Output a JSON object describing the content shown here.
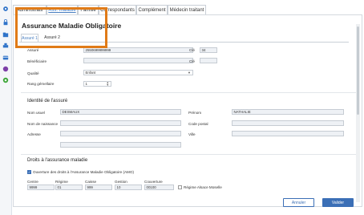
{
  "tabs": [
    {
      "label": "Administratif"
    },
    {
      "label": "Ass. maladie"
    },
    {
      "label": "Famille"
    },
    {
      "label": "Correspondants"
    },
    {
      "label": "Complément"
    },
    {
      "label": "Médecin traitant"
    }
  ],
  "form": {
    "title": "Assurance Maladie Obligatoire",
    "subtabs": [
      "Assuré 1",
      "Assuré 2"
    ],
    "assure_label": "Assuré",
    "assure_value": "2550699999999",
    "cle_label": "Clé",
    "cle_value": "34",
    "beneficiaire_label": "Bénéficiaire",
    "beneficiaire_value": "",
    "cle2_label": "Clé",
    "cle2_value": "",
    "qualite_label": "Qualité",
    "qualite_value": "Enfant",
    "rang_label": "Rang gémellaire",
    "rang_value": "1"
  },
  "identite": {
    "section_title": "Identité de l'assuré",
    "nom_usuel_label": "Nom usuel",
    "nom_usuel_value": "DESMAUX",
    "prenom_label": "Prénom",
    "prenom_value": "NATHALIE",
    "nom_naissance_label": "Nom de naissance",
    "code_postal_label": "Code postal",
    "adresse_label": "Adresse",
    "ville_label": "Ville"
  },
  "droits": {
    "section_title": "Droits à l'assurance maladie",
    "ouverture_label": "Ouverture des droits à l'Assurance Maladie Obligatoire (AMO)",
    "centre_label": "Centre",
    "centre_value": "9999",
    "regime_label": "Régime",
    "regime_value": "01",
    "caisse_label": "Caisse",
    "caisse_value": "999",
    "gestion_label": "Gestion",
    "gestion_value": "10",
    "couverture_label": "Couverture",
    "couverture_value": "00100",
    "alsace_label": "Régime Alsace Moselle"
  },
  "buttons": {
    "cancel": "Annuler",
    "ok": "Valider"
  },
  "sidebar_icons": [
    "gear-icon",
    "lock-icon",
    "folder-icon",
    "printer-icon",
    "card-icon",
    "purple-circle-icon",
    "chat-icon"
  ],
  "colors": {
    "accent": "#3b6fb6",
    "highlight": "#e07b18"
  }
}
